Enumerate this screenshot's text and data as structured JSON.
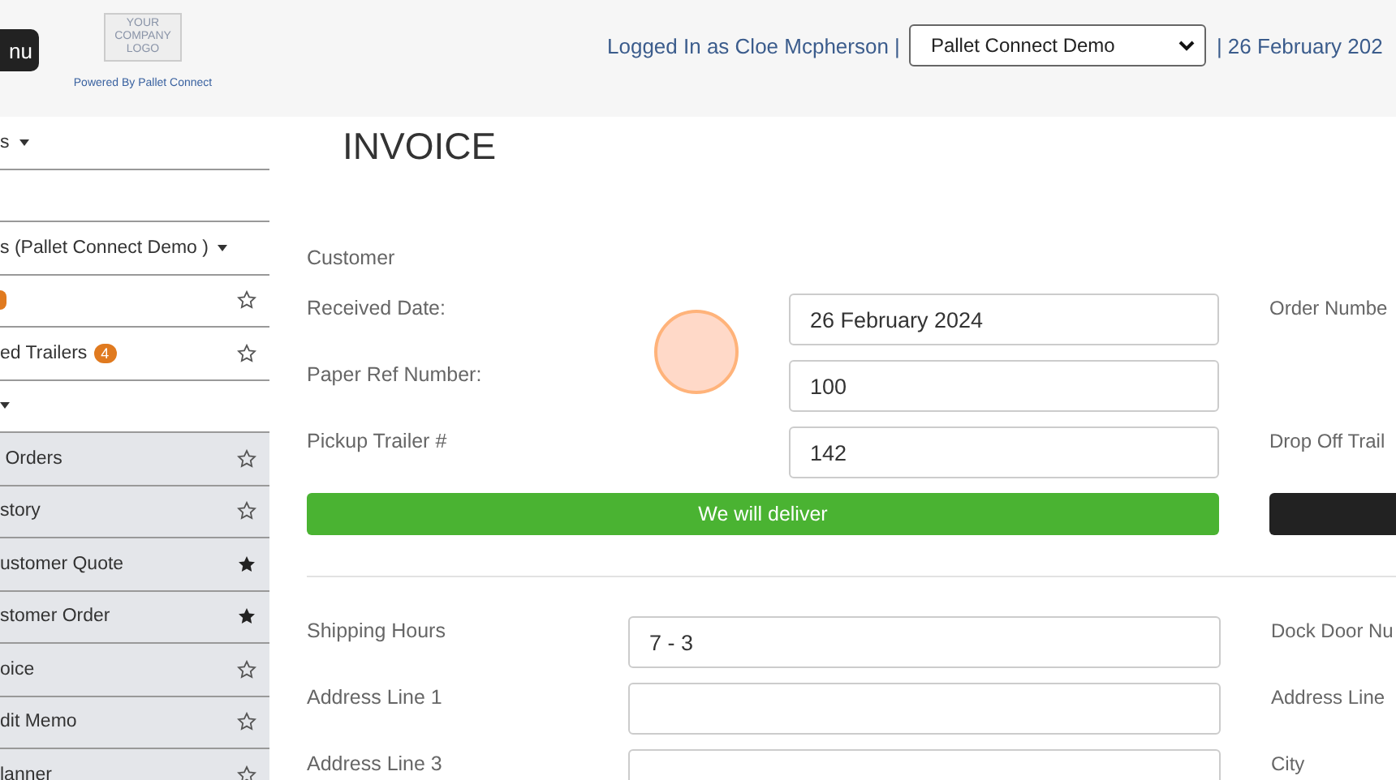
{
  "header": {
    "menu_button": "nu",
    "logo": [
      "YOUR",
      "COMPANY",
      "LOGO"
    ],
    "powered_by": "Powered By Pallet Connect",
    "user": "Logged In as Cloe Mcpherson |",
    "company_select": "Pallet Connect Demo",
    "date": "| 26 February 202"
  },
  "sidebar": {
    "items": [
      {
        "kind": "section",
        "label": "s",
        "caret": true
      },
      {
        "kind": "section",
        "caret": false
      },
      {
        "kind": "section",
        "label": "s (Pallet Connect Demo )",
        "caret": true
      },
      {
        "kind": "top-link",
        "partial_badge": true,
        "starred": false
      },
      {
        "kind": "top-link",
        "label": "ed Trailers",
        "badge": "4",
        "starred": false
      },
      {
        "kind": "section",
        "caret": true
      },
      {
        "kind": "link",
        "label": " Orders",
        "starred": false
      },
      {
        "kind": "link",
        "label": "story",
        "starred": false
      },
      {
        "kind": "link",
        "label": "ustomer Quote",
        "starred": true
      },
      {
        "kind": "link",
        "label": "stomer Order",
        "starred": true
      },
      {
        "kind": "link",
        "label": "oice",
        "starred": false
      },
      {
        "kind": "link",
        "label": "dit Memo",
        "starred": false
      },
      {
        "kind": "link",
        "label": "lanner",
        "starred": false
      }
    ]
  },
  "invoice": {
    "title": "INVOICE",
    "sections": [
      {
        "rows": [
          {
            "kind": "field",
            "label": "Customer"
          },
          {
            "kind": "field",
            "label": "Received Date:",
            "value": "26 February 2024",
            "right": {
              "kind": "label",
              "text": "Order Numbe"
            }
          },
          {
            "kind": "field",
            "label": "Paper Ref Number:",
            "value": "100"
          },
          {
            "kind": "field",
            "label": "Pickup Trailer #",
            "value": "142",
            "right": {
              "kind": "label",
              "text": "Drop Off Trail"
            }
          },
          {
            "kind": "button",
            "label": "We will deliver",
            "right": {
              "kind": "button"
            }
          }
        ]
      },
      {
        "rows": [
          {
            "kind": "field",
            "label": "Shipping Hours",
            "value": "7 - 3",
            "right": {
              "kind": "label",
              "text": "Dock Door Nu"
            }
          },
          {
            "kind": "field",
            "label": "Address Line 1",
            "value": "",
            "right": {
              "kind": "label",
              "text": "Address Line"
            }
          },
          {
            "kind": "field",
            "label": "Address Line 3",
            "value": "",
            "right": {
              "kind": "label",
              "text": "City"
            }
          }
        ]
      }
    ]
  }
}
